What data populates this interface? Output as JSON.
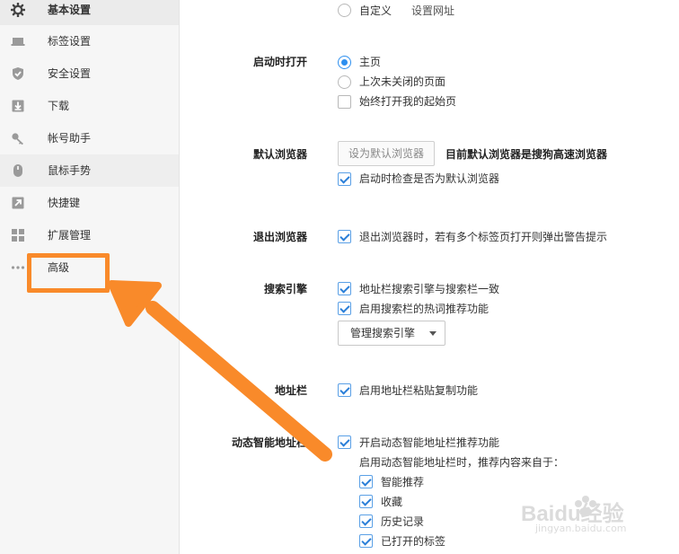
{
  "sidebar": {
    "items": [
      {
        "label": "基本设置",
        "icon": "gear-icon"
      },
      {
        "label": "标签设置",
        "icon": "laptop-icon"
      },
      {
        "label": "安全设置",
        "icon": "shield-check-icon"
      },
      {
        "label": "下载",
        "icon": "download-icon"
      },
      {
        "label": "帐号助手",
        "icon": "key-icon"
      },
      {
        "label": "鼠标手势",
        "icon": "mouse-icon"
      },
      {
        "label": "快捷键",
        "icon": "shortcut-arrow-icon"
      },
      {
        "label": "扩展管理",
        "icon": "extensions-grid-icon"
      },
      {
        "label": "高级",
        "icon": "more-dots-icon"
      }
    ]
  },
  "homepage": {
    "custom_label": "自定义",
    "set_url_link": "设置网址"
  },
  "startup": {
    "title": "启动时打开",
    "options": [
      "主页",
      "上次未关闭的页面"
    ],
    "always_open_label": "始终打开我的起始页"
  },
  "default_browser": {
    "title": "默认浏览器",
    "button_label": "设为默认浏览器",
    "status_text": "目前默认浏览器是搜狗高速浏览器",
    "check_on_start_label": "启动时检查是否为默认浏览器"
  },
  "exit_browser": {
    "title": "退出浏览器",
    "warn_label": "退出浏览器时，若有多个标签页打开则弹出警告提示"
  },
  "search_engine": {
    "title": "搜索引擎",
    "sync_label": "地址栏搜索引擎与搜索栏一致",
    "hot_words_label": "启用搜索栏的热词推荐功能",
    "manage_label": "管理搜索引擎"
  },
  "address_bar": {
    "title": "地址栏",
    "paste_copy_label": "启用地址栏粘贴复制功能"
  },
  "smart_address_bar": {
    "title": "动态智能地址栏",
    "enable_label": "开启动态智能地址栏推荐功能",
    "source_desc": "启用动态智能地址栏时，推荐内容来自于：",
    "sources": [
      "智能推荐",
      "收藏",
      "历史记录",
      "已打开的标签"
    ]
  },
  "watermark": {
    "brand": "Baidu经验",
    "url": "jingyan.baidu.com"
  },
  "colors": {
    "accent_blue": "#2d8fef",
    "annotation_orange": "#f98a2a"
  }
}
